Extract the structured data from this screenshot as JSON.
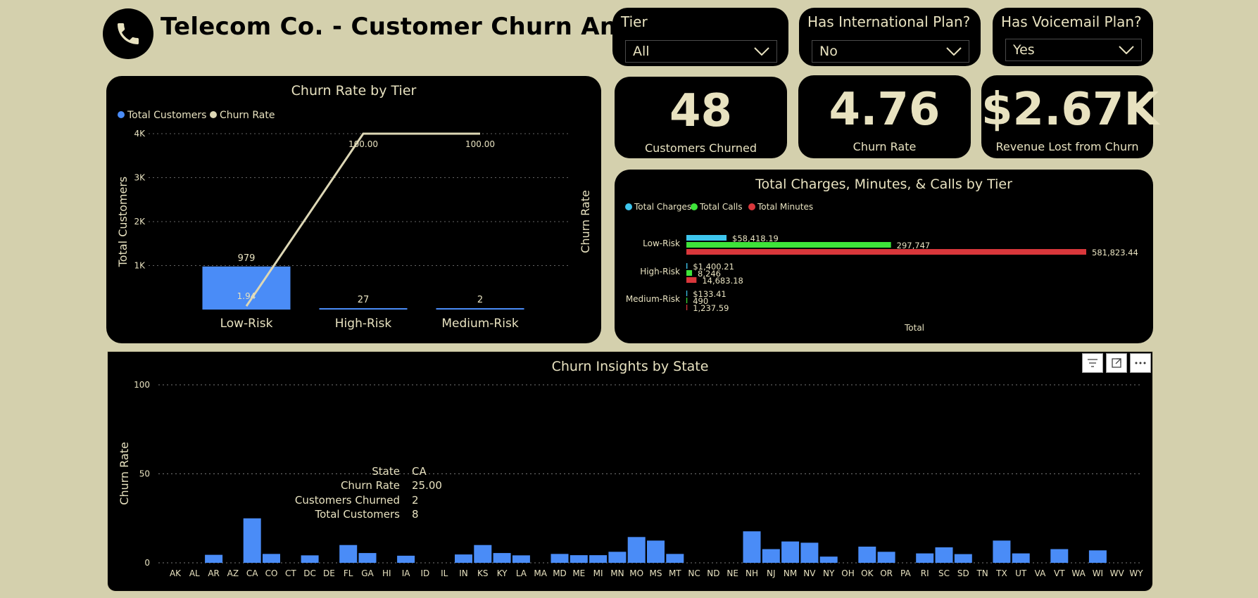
{
  "title": "Telecom Co. - Customer Churn Analysis",
  "slicers": [
    {
      "label": "Tier",
      "value": "All"
    },
    {
      "label": "Has International Plan?",
      "value": "No"
    },
    {
      "label": "Has Voicemail Plan?",
      "value": "Yes"
    }
  ],
  "kpis": [
    {
      "value": "48",
      "label": "Customers Churned"
    },
    {
      "value": "4.76",
      "label": "Churn Rate"
    },
    {
      "value": "$2.67K",
      "label": "Revenue Lost from Churn"
    }
  ],
  "colors": {
    "background": "#d4d0ad",
    "panel": "#000000",
    "text": "#e8e2c0",
    "blue": "#4a8cf7",
    "line": "#ddd7b5",
    "cyan": "#3ec6ee",
    "green": "#3ee33a",
    "red": "#d9373b"
  },
  "chart_data": [
    {
      "type": "bar+line",
      "title": "Churn Rate by Tier",
      "legend": [
        "Total Customers",
        "Churn Rate"
      ],
      "ylabel": "Total Customers",
      "y2label": "Churn Rate",
      "ylim": [
        0,
        4000
      ],
      "yticks": [
        "4K",
        "3K",
        "2K",
        "1K"
      ],
      "categories": [
        "Low-Risk",
        "High-Risk",
        "Medium-Risk"
      ],
      "series": [
        {
          "name": "Total Customers",
          "values": [
            979,
            27,
            2
          ],
          "labels": [
            "979",
            "27",
            "2"
          ]
        },
        {
          "name": "Churn Rate",
          "values": [
            1.94,
            100.0,
            100.0
          ],
          "labels": [
            "1.94",
            "100.00",
            "100.00"
          ]
        }
      ]
    },
    {
      "type": "bar",
      "orientation": "horizontal",
      "title": "Total Charges, Minutes, & Calls by Tier",
      "xlabel": "Total",
      "legend": [
        "Total Charges",
        "Total Calls",
        "Total Minutes"
      ],
      "categories": [
        "Low-Risk",
        "High-Risk",
        "Medium-Risk"
      ],
      "series": [
        {
          "name": "Total Charges",
          "values": [
            58418.19,
            1400.21,
            133.41
          ],
          "labels": [
            "$58,418.19",
            "$1,400.21",
            "$133.41"
          ]
        },
        {
          "name": "Total Calls",
          "values": [
            297747,
            8246,
            490
          ],
          "labels": [
            "297,747",
            "8,246",
            "490"
          ]
        },
        {
          "name": "Total Minutes",
          "values": [
            581823.44,
            14683.18,
            1237.59
          ],
          "labels": [
            "581,823.44",
            "14,683.18",
            "1,237.59"
          ]
        }
      ]
    },
    {
      "type": "bar",
      "title": "Churn Insights by State",
      "ylabel": "Churn Rate",
      "ylim": [
        0,
        100
      ],
      "yticks": [
        "100",
        "50",
        "0"
      ],
      "categories": [
        "AK",
        "AL",
        "AR",
        "AZ",
        "CA",
        "CO",
        "CT",
        "DC",
        "DE",
        "FL",
        "GA",
        "HI",
        "IA",
        "ID",
        "IL",
        "IN",
        "KS",
        "KY",
        "LA",
        "MA",
        "MD",
        "ME",
        "MI",
        "MN",
        "MO",
        "MS",
        "MT",
        "NC",
        "ND",
        "NE",
        "NH",
        "NJ",
        "NM",
        "NV",
        "NY",
        "OH",
        "OK",
        "OR",
        "PA",
        "RI",
        "SC",
        "SD",
        "TN",
        "TX",
        "UT",
        "VA",
        "VT",
        "WA",
        "WI",
        "WV",
        "WY"
      ],
      "values": [
        0,
        0,
        4.5,
        0,
        25,
        5,
        0,
        4.2,
        0,
        10,
        5.5,
        0,
        4,
        0,
        0,
        4.7,
        10,
        5.5,
        4.2,
        0,
        5,
        4.3,
        4.3,
        6.2,
        14.5,
        12.5,
        5,
        0,
        0,
        0,
        17.7,
        7.7,
        12,
        11.3,
        3.5,
        0,
        9.1,
        6.2,
        0,
        5.3,
        8.7,
        4.9,
        0,
        12.5,
        5.3,
        0,
        7.7,
        0,
        7,
        0
      ],
      "tooltip": [
        {
          "key": "State",
          "value": "CA"
        },
        {
          "key": "Churn Rate",
          "value": "25.00"
        },
        {
          "key": "Customers Churned",
          "value": "2"
        },
        {
          "key": "Total Customers",
          "value": "8"
        }
      ]
    }
  ]
}
